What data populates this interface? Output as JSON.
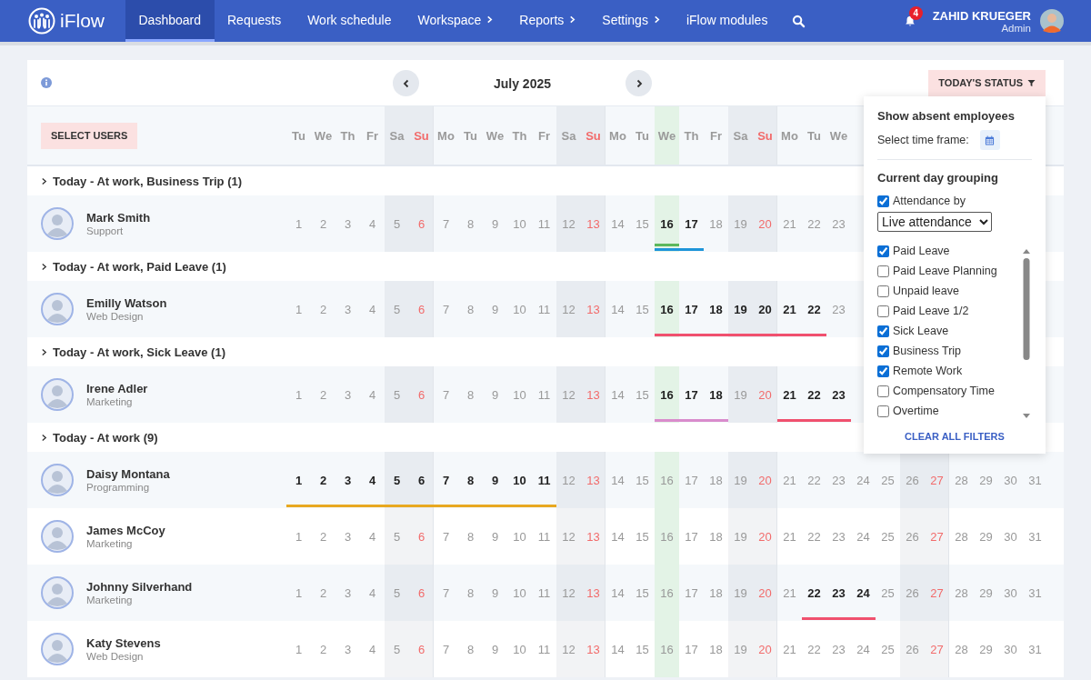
{
  "app": {
    "name": "iFlow"
  },
  "nav": [
    {
      "label": "Dashboard",
      "selected": true,
      "has_submenu": false
    },
    {
      "label": "Requests",
      "selected": false,
      "has_submenu": false
    },
    {
      "label": "Work schedule",
      "selected": false,
      "has_submenu": false
    },
    {
      "label": "Workspace",
      "selected": false,
      "has_submenu": true
    },
    {
      "label": "Reports",
      "selected": false,
      "has_submenu": true
    },
    {
      "label": "Settings",
      "selected": false,
      "has_submenu": true
    },
    {
      "label": "iFlow modules",
      "selected": false,
      "has_submenu": false
    }
  ],
  "notifications": {
    "count": "4"
  },
  "user": {
    "name": "ZAHID KRUEGER",
    "role": "Admin"
  },
  "toolbar": {
    "month": "July 2025",
    "status_button": "TODAY'S STATUS",
    "select_users": "SELECT USERS"
  },
  "weekdays": [
    {
      "label": "Tu",
      "kind": "weekday"
    },
    {
      "label": "We",
      "kind": "weekday"
    },
    {
      "label": "Th",
      "kind": "weekday"
    },
    {
      "label": "Fr",
      "kind": "weekday"
    },
    {
      "label": "Sa",
      "kind": "saturday"
    },
    {
      "label": "Su",
      "kind": "sunday"
    },
    {
      "label": "Mo",
      "kind": "weekday"
    },
    {
      "label": "Tu",
      "kind": "weekday"
    },
    {
      "label": "We",
      "kind": "weekday"
    },
    {
      "label": "Th",
      "kind": "weekday"
    },
    {
      "label": "Fr",
      "kind": "weekday"
    },
    {
      "label": "Sa",
      "kind": "saturday"
    },
    {
      "label": "Su",
      "kind": "sunday"
    },
    {
      "label": "Mo",
      "kind": "weekday"
    },
    {
      "label": "Tu",
      "kind": "weekday"
    },
    {
      "label": "We",
      "kind": "today"
    },
    {
      "label": "Th",
      "kind": "weekday"
    },
    {
      "label": "Fr",
      "kind": "weekday"
    },
    {
      "label": "Sa",
      "kind": "saturday"
    },
    {
      "label": "Su",
      "kind": "sunday"
    },
    {
      "label": "Mo",
      "kind": "weekday"
    },
    {
      "label": "Tu",
      "kind": "weekday"
    },
    {
      "label": "We",
      "kind": "weekday"
    }
  ],
  "groups": [
    {
      "title": "Today - At work, Business Trip (1)",
      "employees": [
        {
          "name": "Mark Smith",
          "department": "Support",
          "days": [
            {
              "n": "1",
              "kind": "weekday",
              "on": false
            },
            {
              "n": "2",
              "kind": "weekday",
              "on": false
            },
            {
              "n": "3",
              "kind": "weekday",
              "on": false
            },
            {
              "n": "4",
              "kind": "weekday",
              "on": false
            },
            {
              "n": "5",
              "kind": "saturday",
              "on": false
            },
            {
              "n": "6",
              "kind": "sunday",
              "on": false
            },
            {
              "n": "7",
              "kind": "weekday",
              "on": false
            },
            {
              "n": "8",
              "kind": "weekday",
              "on": false
            },
            {
              "n": "9",
              "kind": "weekday",
              "on": false
            },
            {
              "n": "10",
              "kind": "weekday",
              "on": false
            },
            {
              "n": "11",
              "kind": "weekday",
              "on": false
            },
            {
              "n": "12",
              "kind": "saturday",
              "on": false
            },
            {
              "n": "13",
              "kind": "sunday",
              "on": false
            },
            {
              "n": "14",
              "kind": "weekday",
              "on": false
            },
            {
              "n": "15",
              "kind": "weekday",
              "on": false
            },
            {
              "n": "16",
              "kind": "today",
              "on": true,
              "bars": [
                {
                  "color": "#5cb85c"
                },
                {
                  "color": "#1e95d9"
                }
              ]
            },
            {
              "n": "17",
              "kind": "weekday",
              "on": true,
              "bars": [
                {
                  "color": "#1e95d9"
                }
              ]
            },
            {
              "n": "18",
              "kind": "weekday",
              "on": false
            },
            {
              "n": "19",
              "kind": "saturday",
              "on": false
            },
            {
              "n": "20",
              "kind": "sunday",
              "on": false
            },
            {
              "n": "21",
              "kind": "weekday",
              "on": false
            },
            {
              "n": "22",
              "kind": "weekday",
              "on": false
            },
            {
              "n": "23",
              "kind": "weekday",
              "on": false
            }
          ]
        }
      ]
    },
    {
      "title": "Today - At work, Paid Leave (1)",
      "employees": [
        {
          "name": "Emilly Watson",
          "department": "Web Design",
          "days": [
            {
              "n": "1",
              "kind": "weekday",
              "on": false
            },
            {
              "n": "2",
              "kind": "weekday",
              "on": false
            },
            {
              "n": "3",
              "kind": "weekday",
              "on": false
            },
            {
              "n": "4",
              "kind": "weekday",
              "on": false
            },
            {
              "n": "5",
              "kind": "saturday",
              "on": false
            },
            {
              "n": "6",
              "kind": "sunday",
              "on": false
            },
            {
              "n": "7",
              "kind": "weekday",
              "on": false
            },
            {
              "n": "8",
              "kind": "weekday",
              "on": false
            },
            {
              "n": "9",
              "kind": "weekday",
              "on": false
            },
            {
              "n": "10",
              "kind": "weekday",
              "on": false
            },
            {
              "n": "11",
              "kind": "weekday",
              "on": false
            },
            {
              "n": "12",
              "kind": "saturday",
              "on": false
            },
            {
              "n": "13",
              "kind": "sunday",
              "on": false
            },
            {
              "n": "14",
              "kind": "weekday",
              "on": false
            },
            {
              "n": "15",
              "kind": "weekday",
              "on": false
            },
            {
              "n": "16",
              "kind": "today",
              "on": true,
              "bars": [
                {
                  "color": "#f0506e"
                }
              ]
            },
            {
              "n": "17",
              "kind": "weekday",
              "on": true,
              "bars": [
                {
                  "color": "#f0506e"
                }
              ]
            },
            {
              "n": "18",
              "kind": "weekday",
              "on": true,
              "bars": [
                {
                  "color": "#f0506e"
                }
              ]
            },
            {
              "n": "19",
              "kind": "saturday",
              "on": true,
              "bars": [
                {
                  "color": "#f0506e"
                }
              ]
            },
            {
              "n": "20",
              "kind": "sunday",
              "on": true,
              "bars": [
                {
                  "color": "#f0506e"
                }
              ]
            },
            {
              "n": "21",
              "kind": "weekday",
              "on": true,
              "bars": [
                {
                  "color": "#f0506e"
                }
              ]
            },
            {
              "n": "22",
              "kind": "weekday",
              "on": true,
              "bars": [
                {
                  "color": "#f0506e"
                }
              ]
            },
            {
              "n": "23",
              "kind": "weekday",
              "on": false
            }
          ]
        }
      ]
    },
    {
      "title": "Today - At work, Sick Leave (1)",
      "employees": [
        {
          "name": "Irene Adler",
          "department": "Marketing",
          "days": [
            {
              "n": "1",
              "kind": "weekday",
              "on": false
            },
            {
              "n": "2",
              "kind": "weekday",
              "on": false
            },
            {
              "n": "3",
              "kind": "weekday",
              "on": false
            },
            {
              "n": "4",
              "kind": "weekday",
              "on": false
            },
            {
              "n": "5",
              "kind": "saturday",
              "on": false
            },
            {
              "n": "6",
              "kind": "sunday",
              "on": false
            },
            {
              "n": "7",
              "kind": "weekday",
              "on": false
            },
            {
              "n": "8",
              "kind": "weekday",
              "on": false
            },
            {
              "n": "9",
              "kind": "weekday",
              "on": false
            },
            {
              "n": "10",
              "kind": "weekday",
              "on": false
            },
            {
              "n": "11",
              "kind": "weekday",
              "on": false
            },
            {
              "n": "12",
              "kind": "saturday",
              "on": false
            },
            {
              "n": "13",
              "kind": "sunday",
              "on": false
            },
            {
              "n": "14",
              "kind": "weekday",
              "on": false
            },
            {
              "n": "15",
              "kind": "weekday",
              "on": false
            },
            {
              "n": "16",
              "kind": "today",
              "on": true,
              "bars": [
                {
                  "color": "#d98ccc"
                }
              ]
            },
            {
              "n": "17",
              "kind": "weekday",
              "on": true,
              "bars": [
                {
                  "color": "#d98ccc"
                }
              ]
            },
            {
              "n": "18",
              "kind": "weekday",
              "on": true,
              "bars": [
                {
                  "color": "#d98ccc"
                }
              ]
            },
            {
              "n": "19",
              "kind": "saturday",
              "on": false
            },
            {
              "n": "20",
              "kind": "sunday",
              "on": false
            },
            {
              "n": "21",
              "kind": "weekday",
              "on": true,
              "bars": [
                {
                  "color": "#f0506e"
                }
              ]
            },
            {
              "n": "22",
              "kind": "weekday",
              "on": true,
              "bars": [
                {
                  "color": "#f0506e"
                }
              ]
            },
            {
              "n": "23",
              "kind": "weekday",
              "on": true,
              "bars": [
                {
                  "color": "#f0506e"
                }
              ]
            }
          ]
        }
      ]
    },
    {
      "title": "Today - At work (9)",
      "employees": [
        {
          "name": "Daisy Montana",
          "department": "Programming",
          "days": [
            {
              "n": "1",
              "kind": "weekday",
              "on": true,
              "bars": [
                {
                  "color": "#e8a820"
                }
              ]
            },
            {
              "n": "2",
              "kind": "weekday",
              "on": true,
              "bars": [
                {
                  "color": "#e8a820"
                }
              ]
            },
            {
              "n": "3",
              "kind": "weekday",
              "on": true,
              "bars": [
                {
                  "color": "#e8a820"
                }
              ]
            },
            {
              "n": "4",
              "kind": "weekday",
              "on": true,
              "bars": [
                {
                  "color": "#e8a820"
                }
              ]
            },
            {
              "n": "5",
              "kind": "saturday",
              "on": true,
              "bars": [
                {
                  "color": "#e8a820"
                }
              ]
            },
            {
              "n": "6",
              "kind": "sunday",
              "on": true,
              "bars": [
                {
                  "color": "#e8a820"
                }
              ]
            },
            {
              "n": "7",
              "kind": "weekday",
              "on": true,
              "bars": [
                {
                  "color": "#e8a820"
                }
              ]
            },
            {
              "n": "8",
              "kind": "weekday",
              "on": true,
              "bars": [
                {
                  "color": "#e8a820"
                }
              ]
            },
            {
              "n": "9",
              "kind": "weekday",
              "on": true,
              "bars": [
                {
                  "color": "#e8a820"
                }
              ]
            },
            {
              "n": "10",
              "kind": "weekday",
              "on": true,
              "bars": [
                {
                  "color": "#e8a820"
                }
              ]
            },
            {
              "n": "11",
              "kind": "weekday",
              "on": true,
              "bars": [
                {
                  "color": "#e8a820"
                }
              ]
            },
            {
              "n": "12",
              "kind": "saturday",
              "on": false
            },
            {
              "n": "13",
              "kind": "sunday",
              "on": false
            },
            {
              "n": "14",
              "kind": "weekday",
              "on": false
            },
            {
              "n": "15",
              "kind": "weekday",
              "on": false
            },
            {
              "n": "16",
              "kind": "today",
              "on": false
            },
            {
              "n": "17",
              "kind": "weekday",
              "on": false
            },
            {
              "n": "18",
              "kind": "weekday",
              "on": false
            },
            {
              "n": "19",
              "kind": "saturday",
              "on": false
            },
            {
              "n": "20",
              "kind": "sunday",
              "on": false
            },
            {
              "n": "21",
              "kind": "weekday",
              "on": false
            },
            {
              "n": "22",
              "kind": "weekday",
              "on": false
            },
            {
              "n": "23",
              "kind": "weekday",
              "on": false
            },
            {
              "n": "24",
              "kind": "weekday",
              "on": false
            },
            {
              "n": "25",
              "kind": "weekday",
              "on": false
            },
            {
              "n": "26",
              "kind": "saturday",
              "on": false
            },
            {
              "n": "27",
              "kind": "sunday",
              "on": false
            },
            {
              "n": "28",
              "kind": "weekday",
              "on": false
            },
            {
              "n": "29",
              "kind": "weekday",
              "on": false
            },
            {
              "n": "30",
              "kind": "weekday",
              "on": false
            },
            {
              "n": "31",
              "kind": "weekday",
              "on": false
            }
          ]
        },
        {
          "name": "James McCoy",
          "department": "Marketing",
          "days": [
            {
              "n": "1",
              "kind": "weekday",
              "on": false
            },
            {
              "n": "2",
              "kind": "weekday",
              "on": false
            },
            {
              "n": "3",
              "kind": "weekday",
              "on": false
            },
            {
              "n": "4",
              "kind": "weekday",
              "on": false
            },
            {
              "n": "5",
              "kind": "saturday",
              "on": false
            },
            {
              "n": "6",
              "kind": "sunday",
              "on": false
            },
            {
              "n": "7",
              "kind": "weekday",
              "on": false
            },
            {
              "n": "8",
              "kind": "weekday",
              "on": false
            },
            {
              "n": "9",
              "kind": "weekday",
              "on": false
            },
            {
              "n": "10",
              "kind": "weekday",
              "on": false
            },
            {
              "n": "11",
              "kind": "weekday",
              "on": false
            },
            {
              "n": "12",
              "kind": "saturday",
              "on": false
            },
            {
              "n": "13",
              "kind": "sunday",
              "on": false
            },
            {
              "n": "14",
              "kind": "weekday",
              "on": false
            },
            {
              "n": "15",
              "kind": "weekday",
              "on": false
            },
            {
              "n": "16",
              "kind": "today",
              "on": false
            },
            {
              "n": "17",
              "kind": "weekday",
              "on": false
            },
            {
              "n": "18",
              "kind": "weekday",
              "on": false
            },
            {
              "n": "19",
              "kind": "saturday",
              "on": false
            },
            {
              "n": "20",
              "kind": "sunday",
              "on": false
            },
            {
              "n": "21",
              "kind": "weekday",
              "on": false
            },
            {
              "n": "22",
              "kind": "weekday",
              "on": false
            },
            {
              "n": "23",
              "kind": "weekday",
              "on": false
            },
            {
              "n": "24",
              "kind": "weekday",
              "on": false
            },
            {
              "n": "25",
              "kind": "weekday",
              "on": false
            },
            {
              "n": "26",
              "kind": "saturday",
              "on": false
            },
            {
              "n": "27",
              "kind": "sunday",
              "on": false
            },
            {
              "n": "28",
              "kind": "weekday",
              "on": false
            },
            {
              "n": "29",
              "kind": "weekday",
              "on": false
            },
            {
              "n": "30",
              "kind": "weekday",
              "on": false
            },
            {
              "n": "31",
              "kind": "weekday",
              "on": false
            }
          ]
        },
        {
          "name": "Johnny Silverhand",
          "department": "Marketing",
          "days": [
            {
              "n": "1",
              "kind": "weekday",
              "on": false
            },
            {
              "n": "2",
              "kind": "weekday",
              "on": false
            },
            {
              "n": "3",
              "kind": "weekday",
              "on": false
            },
            {
              "n": "4",
              "kind": "weekday",
              "on": false
            },
            {
              "n": "5",
              "kind": "saturday",
              "on": false
            },
            {
              "n": "6",
              "kind": "sunday",
              "on": false
            },
            {
              "n": "7",
              "kind": "weekday",
              "on": false
            },
            {
              "n": "8",
              "kind": "weekday",
              "on": false
            },
            {
              "n": "9",
              "kind": "weekday",
              "on": false
            },
            {
              "n": "10",
              "kind": "weekday",
              "on": false
            },
            {
              "n": "11",
              "kind": "weekday",
              "on": false
            },
            {
              "n": "12",
              "kind": "saturday",
              "on": false
            },
            {
              "n": "13",
              "kind": "sunday",
              "on": false
            },
            {
              "n": "14",
              "kind": "weekday",
              "on": false
            },
            {
              "n": "15",
              "kind": "weekday",
              "on": false
            },
            {
              "n": "16",
              "kind": "today",
              "on": false
            },
            {
              "n": "17",
              "kind": "weekday",
              "on": false
            },
            {
              "n": "18",
              "kind": "weekday",
              "on": false
            },
            {
              "n": "19",
              "kind": "saturday",
              "on": false
            },
            {
              "n": "20",
              "kind": "sunday",
              "on": false
            },
            {
              "n": "21",
              "kind": "weekday",
              "on": false
            },
            {
              "n": "22",
              "kind": "weekday",
              "on": true,
              "bars": [
                {
                  "color": "#f0506e"
                }
              ]
            },
            {
              "n": "23",
              "kind": "weekday",
              "on": true,
              "bars": [
                {
                  "color": "#f0506e"
                }
              ]
            },
            {
              "n": "24",
              "kind": "weekday",
              "on": true,
              "bars": [
                {
                  "color": "#f0506e"
                }
              ]
            },
            {
              "n": "25",
              "kind": "weekday",
              "on": false
            },
            {
              "n": "26",
              "kind": "saturday",
              "on": false
            },
            {
              "n": "27",
              "kind": "sunday",
              "on": false
            },
            {
              "n": "28",
              "kind": "weekday",
              "on": false
            },
            {
              "n": "29",
              "kind": "weekday",
              "on": false
            },
            {
              "n": "30",
              "kind": "weekday",
              "on": false
            },
            {
              "n": "31",
              "kind": "weekday",
              "on": false
            }
          ]
        },
        {
          "name": "Katy Stevens",
          "department": "Web Design",
          "days": [
            {
              "n": "1",
              "kind": "weekday",
              "on": false
            },
            {
              "n": "2",
              "kind": "weekday",
              "on": false
            },
            {
              "n": "3",
              "kind": "weekday",
              "on": false
            },
            {
              "n": "4",
              "kind": "weekday",
              "on": false
            },
            {
              "n": "5",
              "kind": "saturday",
              "on": false
            },
            {
              "n": "6",
              "kind": "sunday",
              "on": false
            },
            {
              "n": "7",
              "kind": "weekday",
              "on": false
            },
            {
              "n": "8",
              "kind": "weekday",
              "on": false
            },
            {
              "n": "9",
              "kind": "weekday",
              "on": false
            },
            {
              "n": "10",
              "kind": "weekday",
              "on": false
            },
            {
              "n": "11",
              "kind": "weekday",
              "on": false
            },
            {
              "n": "12",
              "kind": "saturday",
              "on": false
            },
            {
              "n": "13",
              "kind": "sunday",
              "on": false
            },
            {
              "n": "14",
              "kind": "weekday",
              "on": false
            },
            {
              "n": "15",
              "kind": "weekday",
              "on": false
            },
            {
              "n": "16",
              "kind": "today",
              "on": false
            },
            {
              "n": "17",
              "kind": "weekday",
              "on": false
            },
            {
              "n": "18",
              "kind": "weekday",
              "on": false
            },
            {
              "n": "19",
              "kind": "saturday",
              "on": false
            },
            {
              "n": "20",
              "kind": "sunday",
              "on": false
            },
            {
              "n": "21",
              "kind": "weekday",
              "on": false
            },
            {
              "n": "22",
              "kind": "weekday",
              "on": false
            },
            {
              "n": "23",
              "kind": "weekday",
              "on": false
            },
            {
              "n": "24",
              "kind": "weekday",
              "on": false
            },
            {
              "n": "25",
              "kind": "weekday",
              "on": false
            },
            {
              "n": "26",
              "kind": "saturday",
              "on": false
            },
            {
              "n": "27",
              "kind": "sunday",
              "on": false
            },
            {
              "n": "28",
              "kind": "weekday",
              "on": false
            },
            {
              "n": "29",
              "kind": "weekday",
              "on": false
            },
            {
              "n": "30",
              "kind": "weekday",
              "on": false
            },
            {
              "n": "31",
              "kind": "weekday",
              "on": false
            }
          ]
        }
      ]
    }
  ],
  "status_panel": {
    "absent_title": "Show absent employees",
    "time_frame_label": "Select time frame:",
    "grouping_title": "Current day grouping",
    "attendance_by": {
      "label": "Attendance by",
      "checked": true
    },
    "attendance_select": "Live attendance",
    "filters": [
      {
        "label": "Paid Leave",
        "checked": true
      },
      {
        "label": "Paid Leave Planning",
        "checked": false
      },
      {
        "label": "Unpaid leave",
        "checked": false
      },
      {
        "label": "Paid Leave 1/2",
        "checked": false
      },
      {
        "label": "Sick Leave",
        "checked": true
      },
      {
        "label": "Business Trip",
        "checked": true
      },
      {
        "label": "Remote Work",
        "checked": true
      },
      {
        "label": "Compensatory Time",
        "checked": false
      },
      {
        "label": "Overtime",
        "checked": false
      }
    ],
    "clear_button": "CLEAR ALL FILTERS"
  }
}
